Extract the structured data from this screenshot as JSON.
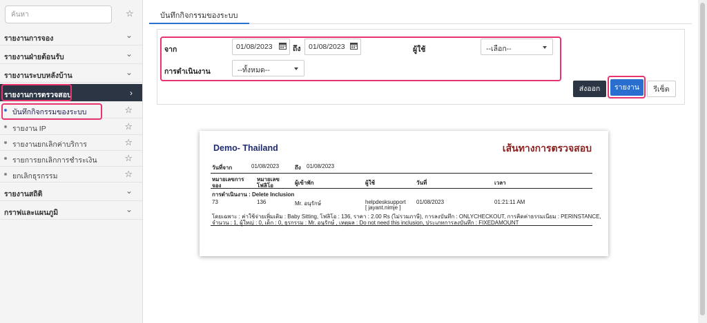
{
  "sidebar": {
    "search_placeholder": "ค้นหา",
    "sections": [
      {
        "label": "รายงานการจอง"
      },
      {
        "label": "รายงานฝ่ายต้อนรับ"
      },
      {
        "label": "รายงานระบบหลังบ้าน"
      },
      {
        "label": "รายงานการตรวจสอบ"
      }
    ],
    "subitems": [
      {
        "label": "บันทึกกิจกรรมของระบบ"
      },
      {
        "label": "รายงาน IP"
      },
      {
        "label": "รายงานยกเลิกค่าบริการ"
      },
      {
        "label": "รายการยกเลิกการชำระเงิน"
      },
      {
        "label": "ยกเลิกธุรกรรม"
      }
    ],
    "bottom_sections": [
      {
        "label": "รายงานสถิติ"
      },
      {
        "label": "กราฟและแผนภูมิ"
      }
    ]
  },
  "tab": {
    "label": "บันทึกกิจกรรมของระบบ"
  },
  "filters": {
    "from_label": "จาก",
    "from_value": "01/08/2023",
    "to_label": "ถึง",
    "to_value": "01/08/2023",
    "user_label": "ผู้ใช้",
    "user_value": "--เลือก--",
    "operation_label": "การดำเนินงาน",
    "operation_value": "--ทั้งหมด--"
  },
  "buttons": {
    "export": "ส่งออก",
    "report": "รายงาน",
    "reset": "รีเซ็ต"
  },
  "report": {
    "company": "Demo- Thailand",
    "title": "เส้นทางการตรวจสอบ",
    "date_from_label": "วันที่จาก",
    "date_from": "01/08/2023",
    "date_to_label": "ถึง",
    "date_to": "01/08/2023",
    "headers": {
      "booking_no_1": "หมายเลขการ",
      "booking_no_2": "จอง",
      "folio_no_1": "หมายเลข",
      "folio_no_2": "โฟลิโอ",
      "guest": "ผู้เข้าพัก",
      "user": "ผู้ใช้",
      "date": "วันที่",
      "time": "เวลา"
    },
    "operation_line": "การดำเนินงาน : Delete Inclusion",
    "row": {
      "booking_no": "73",
      "folio_no": "136",
      "guest": "Mr. อนุรักษ์",
      "user_1": "helpdesksupport",
      "user_2": "[ jayant.nimje ]",
      "date": "01/08/2023",
      "time": "01:21:11 AM"
    },
    "detail_1": "โดยเฉพาะ : ค่าใช้จ่ายเพิ่มเติม : Baby Sitting, โฟลิโอ : 136, ราคา : 2.00 Rs (ไม่รวมภาษี), การลงบันทึก : ONLYCHECKOUT, การคิดค่าธรรมเนียม : PERINSTANCE,",
    "detail_2": "จำนวน : 1, ผู้ใหญ่ : 0, เด็ก : 0, ธุรกรรม : Mr. อนุรักษ์ , เหตุผล : Do not need this inclusion, ประเภทการลงบันทึก : FIXEDAMOUNT"
  },
  "colors": {
    "highlight": "#e8336d",
    "active_section_bg": "#2b3543",
    "primary_button": "#2a6fd0",
    "report_company": "#1e2a6e",
    "report_title": "#8b1e1e"
  }
}
